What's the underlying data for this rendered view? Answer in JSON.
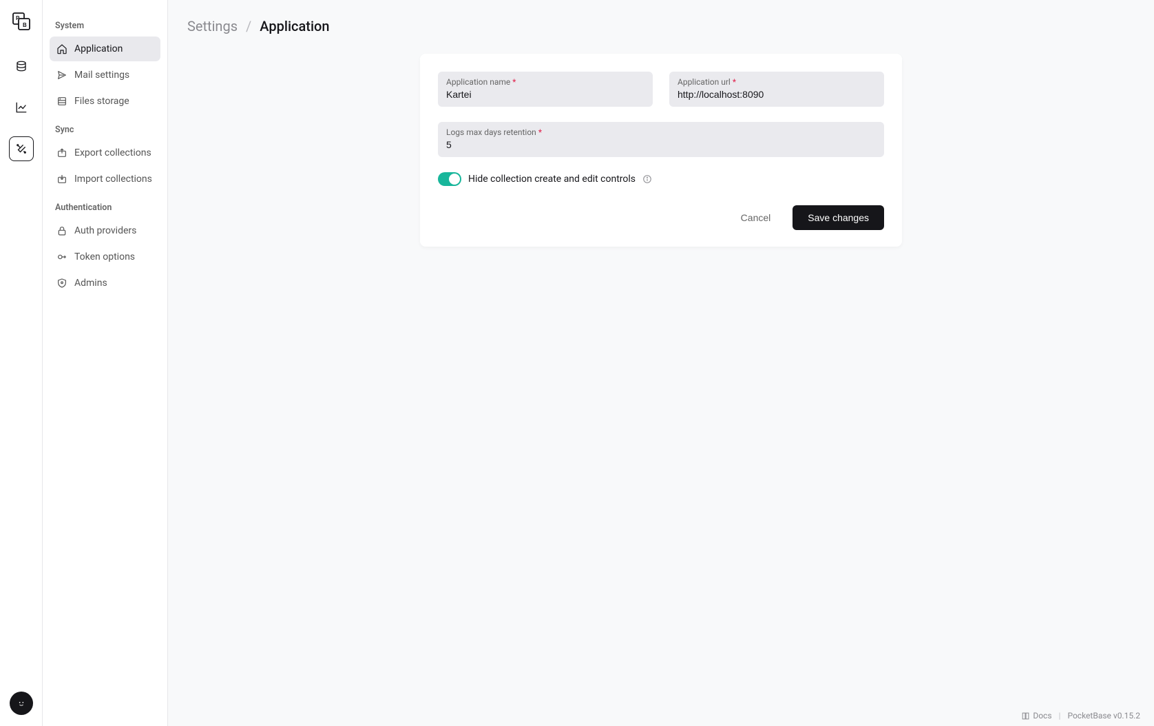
{
  "breadcrumb": {
    "parent": "Settings",
    "current": "Application"
  },
  "sidebar": {
    "groups": [
      {
        "heading": "System",
        "items": [
          {
            "icon": "home-icon",
            "label": "Application",
            "active": true
          },
          {
            "icon": "send-icon",
            "label": "Mail settings"
          },
          {
            "icon": "storage-icon",
            "label": "Files storage"
          }
        ]
      },
      {
        "heading": "Sync",
        "items": [
          {
            "icon": "export-icon",
            "label": "Export collections"
          },
          {
            "icon": "import-icon",
            "label": "Import collections"
          }
        ]
      },
      {
        "heading": "Authentication",
        "items": [
          {
            "icon": "lock-icon",
            "label": "Auth providers"
          },
          {
            "icon": "key-icon",
            "label": "Token options"
          },
          {
            "icon": "shield-icon",
            "label": "Admins"
          }
        ]
      }
    ]
  },
  "form": {
    "app_name_label": "Application name",
    "app_name_value": "Kartei",
    "app_url_label": "Application url",
    "app_url_value": "http://localhost:8090",
    "logs_label": "Logs max days retention",
    "logs_value": "5",
    "toggle_label": "Hide collection create and edit controls",
    "toggle_on": true,
    "cancel_label": "Cancel",
    "save_label": "Save changes"
  },
  "footer": {
    "docs_label": "Docs",
    "version": "PocketBase v0.15.2"
  }
}
